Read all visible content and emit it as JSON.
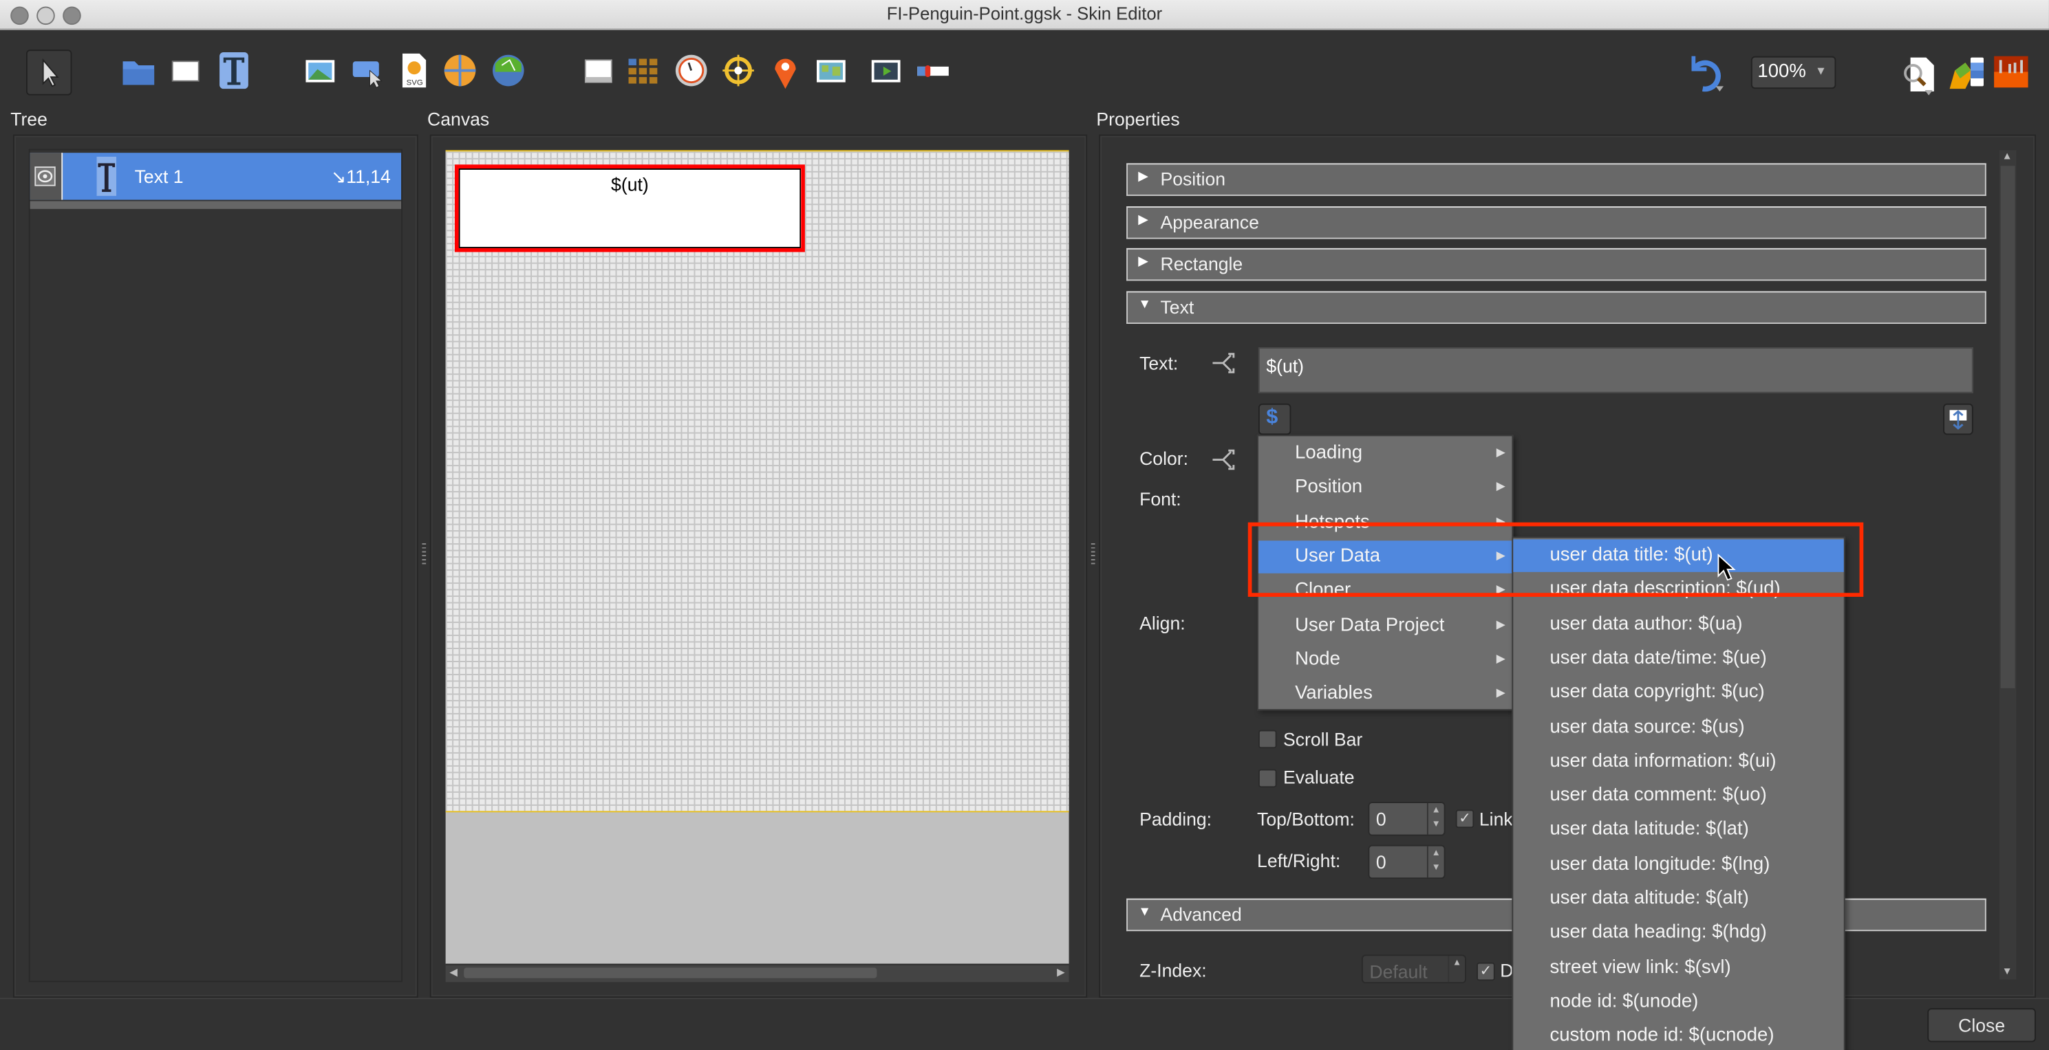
{
  "window": {
    "title": "FI-Penguin-Point.ggsk - Skin Editor"
  },
  "toolbar": {
    "left_icons": [
      "select-pointer-icon",
      "open-folder-icon",
      "rectangle-icon",
      "text-icon",
      "image-icon",
      "button-icon",
      "svg-icon",
      "panorama-globe-icon",
      "node-map-icon",
      "container-icon",
      "cloner-icon",
      "timer-gauge-icon",
      "hotspot-target-icon",
      "map-pin-icon",
      "map-icon",
      "video-icon",
      "scrollbar-slider-icon"
    ],
    "undo_icon": "undo-icon",
    "zoom": "100%",
    "right_icons": [
      "preview-icon",
      "theme-palette-icon",
      "toolbox-icon"
    ]
  },
  "tree": {
    "label": "Tree",
    "items": [
      {
        "name": "Text 1",
        "position": "↘11,14",
        "icon": "text-icon",
        "visible_icon": "eye-icon"
      }
    ]
  },
  "canvas": {
    "label": "Canvas",
    "element_text": "$(ut)"
  },
  "properties": {
    "label": "Properties",
    "sections": {
      "position": "Position",
      "appearance": "Appearance",
      "rectangle": "Rectangle",
      "text": "Text",
      "advanced": "Advanced"
    },
    "text_label": "Text:",
    "text_value": "$(ut)",
    "placeholder_button": "$",
    "color_label": "Color:",
    "font_label": "Font:",
    "align_label": "Align:",
    "scroll_bar": "Scroll Bar",
    "evaluate": "Evaluate",
    "padding_label": "Padding:",
    "top_bottom_label": "Top/Bottom:",
    "top_bottom_value": "0",
    "link_label": "Link",
    "left_right_label": "Left/Right:",
    "left_right_value": "0",
    "zindex_label": "Z-Index:",
    "zindex_value": "Default",
    "zindex_check_label": "D"
  },
  "menu": {
    "items": [
      "Loading",
      "Position",
      "Hotspots",
      "User Data",
      "Cloner",
      "User Data Project",
      "Node",
      "Variables"
    ],
    "highlighted": "User Data"
  },
  "submenu": {
    "items": [
      "user data title: $(ut)",
      "user data description: $(ud)",
      "user data author: $(ua)",
      "user data date/time: $(ue)",
      "user data copyright: $(uc)",
      "user data source: $(us)",
      "user data information: $(ui)",
      "user data comment: $(uo)",
      "user data latitude: $(lat)",
      "user data longitude: $(lng)",
      "user data altitude: $(alt)",
      "user data heading: $(hdg)",
      "street view link: $(svl)",
      "node id: $(unode)",
      "custom node id: $(ucnode)"
    ],
    "highlighted": "user data title: $(ut)"
  },
  "footer": {
    "close": "Close"
  },
  "colors": {
    "accent": "#5088de",
    "annotation": "#ff2a00",
    "background": "#323232",
    "selection_border": "#ff0000"
  }
}
